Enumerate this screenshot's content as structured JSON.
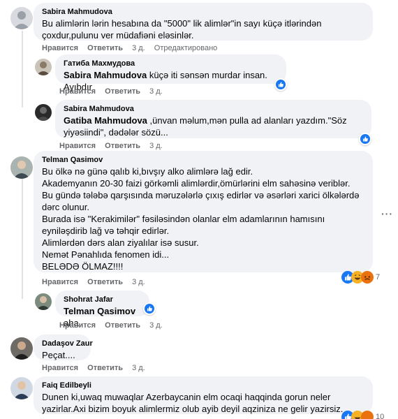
{
  "actions": {
    "like": "Нравится",
    "reply": "Ответить",
    "edited": "Отредактировано"
  },
  "icons": {
    "like": "like-reaction-icon",
    "haha": "haha-reaction-icon",
    "angry": "angry-reaction-icon",
    "more": "more-options-icon"
  },
  "colors": {
    "like_blue": "#1877f2",
    "haha_yellow": "#f7b125",
    "angry_orange": "#e9710f",
    "bubble": "#f0f2f5"
  },
  "comments": [
    {
      "author": "Sabira Mahmudova",
      "text": "Bu alimlərin lərin hesabına da \"5000\" lik alimlər\"in sayı küçə itlərindən çoxdur,pulunu ver müdafiəni eləsinlər.",
      "time": "3 д."
    },
    {
      "author": "Гатиба Махмудова",
      "tag": "Sabira Mahmudova",
      "text": " küçə iti sənsən murdar insan. Ayıbdır",
      "time": "3 д."
    },
    {
      "author": "Sabira Mahmudova",
      "tag": "Gatiba Mahmudova",
      "text": " ,ünvan məlum,mən pulla ad alanları yazdım.\"Söz yiyəsiindi\", dədələr sözü...",
      "time": "3 д."
    },
    {
      "author": "Telman Qasimov",
      "text": "Bu ölkə nə günə qalıb ki,bıvşıy alko alimlərə lağ edir.\nAkademyanın 20-30 faizi görkəmli alimlərdir,ömürlərini elm sahəsinə veriblər.\nBu gündə tələbə qarşısında məruzələrlə çıxış edirlər və əsərləri xarici ölkələrdə dərc olunur.\nBurada isə \"Kerakimilər\" fəsiləsindən olanlar elm adamlarının hamısını eyniləşdirib lağ və təhqir edirlər.\nAlimlərdən dərs alan ziyalılar isə susur.\nNemət Pənahlıda fenomen idi...\nBELƏDƏ ÖLMAZ!!!!",
      "time": "3 д.",
      "reaction_count": "7"
    },
    {
      "author": "Shohrat Jafar",
      "tag": "Telman Qasimov",
      "text": " aha",
      "time": "3 д."
    },
    {
      "author": "Dadaşov Zaur",
      "text": "Peçat....",
      "time": "3 д."
    },
    {
      "author": "Faiq Edilbeyli",
      "text": "Dunen ki,uwaq muwaqlar Azerbaycanin elm ocaqi haqqinda gorun neler yazirlar.Axi bizim boyuk alimlermiz olub ayib deyil aqziniza ne gelir yazirsiz.",
      "reaction_count": "10"
    }
  ]
}
